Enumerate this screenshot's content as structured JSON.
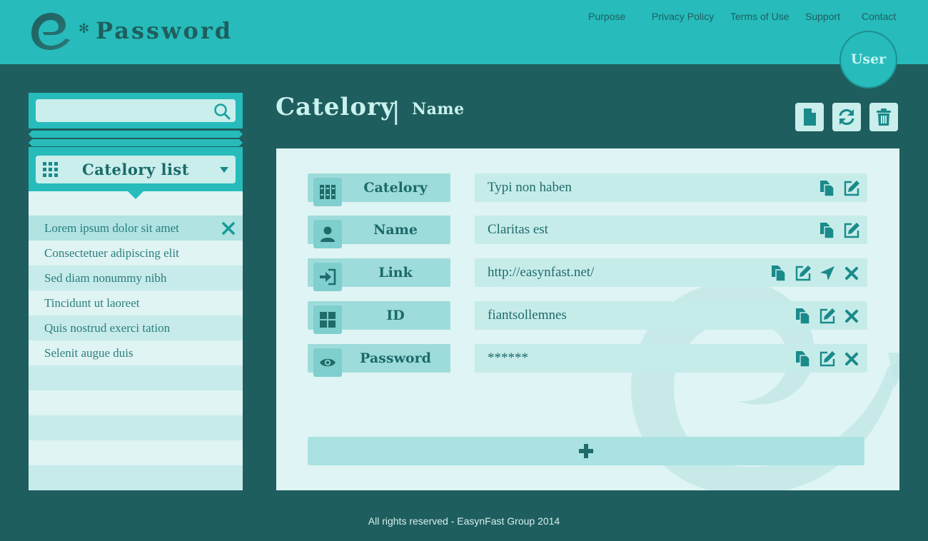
{
  "header": {
    "brand_text": "Password",
    "nav": [
      "Purpose",
      "Privacy Policy",
      "Terms of Use",
      "Support",
      "Contact"
    ],
    "user_label": "User"
  },
  "sidebar": {
    "search": {
      "placeholder": "",
      "value": ""
    },
    "category_select": {
      "label": "Catelory list"
    },
    "items": [
      "Lorem ipsum dolor sit amet",
      "Consectetuer adipiscing elit",
      "Sed diam nonummy nibh",
      "Tincidunt ut laoreet",
      "Quis nostrud exerci tation",
      "Selenit augue duis"
    ],
    "selected_index": 0
  },
  "main": {
    "title": "Catelory",
    "title_separator": "|",
    "subtitle": "Name",
    "toolbar": [
      "file-icon",
      "refresh-icon",
      "trash-icon"
    ],
    "fields": [
      {
        "label": "Catelory",
        "value": "Typi non haben",
        "icon": "books-icon",
        "actions": [
          "copy-icon",
          "edit-icon"
        ]
      },
      {
        "label": "Name",
        "value": "Claritas est",
        "icon": "person-icon",
        "actions": [
          "copy-icon",
          "edit-icon"
        ]
      },
      {
        "label": "Link",
        "value": "http://easynfast.net/",
        "icon": "login-icon",
        "actions": [
          "copy-icon",
          "edit-icon",
          "send-icon",
          "close-icon"
        ]
      },
      {
        "label": "ID",
        "value": "fiantsollemnes",
        "icon": "grid-icon",
        "actions": [
          "copy-icon",
          "edit-icon",
          "close-icon"
        ]
      },
      {
        "label": "Password",
        "value": "******",
        "icon": "eye-icon",
        "actions": [
          "copy-icon",
          "edit-icon",
          "close-icon"
        ]
      }
    ],
    "add_button": "plus-icon"
  },
  "footer": {
    "text": "All rights reserved - EasynFast Group 2014"
  },
  "colors": {
    "background": "#1f5e5e",
    "accent": "#27bbbb",
    "panel": "#dff4f4",
    "label_fill": "#9edcdb",
    "value_fill": "#c6ecea",
    "icon": "#1a8a8a"
  }
}
